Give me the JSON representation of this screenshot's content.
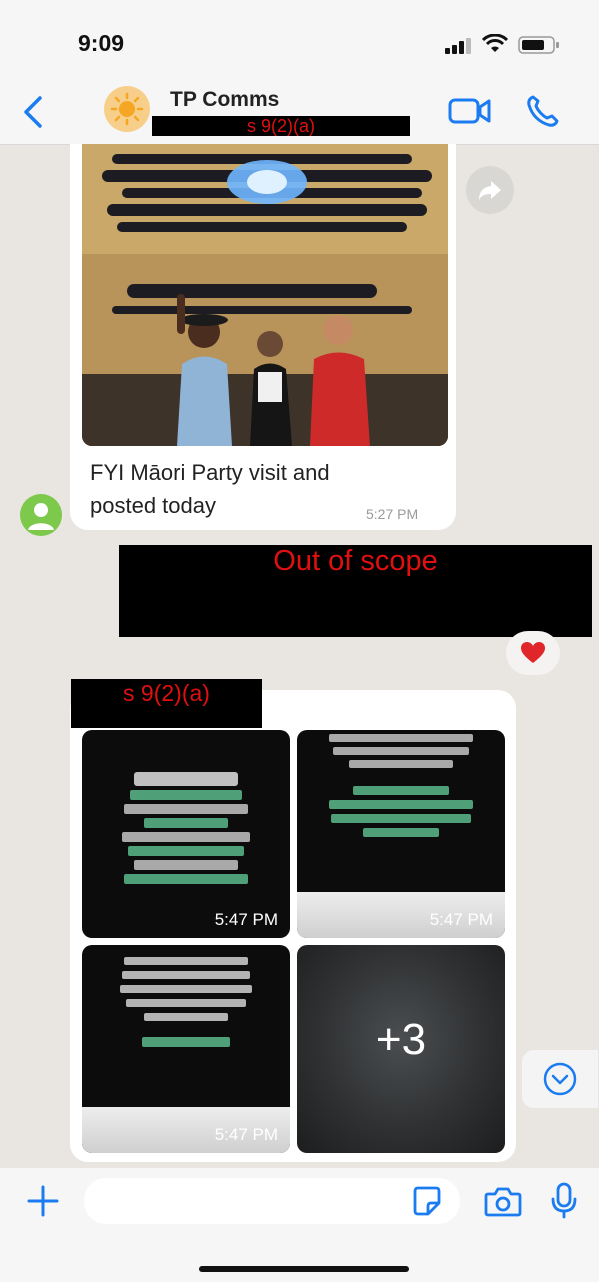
{
  "status_bar": {
    "time": "9:09"
  },
  "header": {
    "contact_name": "TP Comms",
    "redaction_label": "s 9(2)(a)"
  },
  "messages": [
    {
      "type": "image",
      "caption": "FYI Māori Party visit and posted today",
      "timestamp": "5:27 PM"
    },
    {
      "type": "redacted",
      "label": "Out of scope",
      "reaction": "heart"
    },
    {
      "type": "album",
      "sender_redaction": "s 9(2)(a)",
      "tiles": [
        {
          "timestamp": "5:47 PM"
        },
        {
          "timestamp": "5:47 PM"
        },
        {
          "timestamp": "5:47 PM"
        },
        {
          "more_count": "+3"
        }
      ]
    }
  ],
  "colors": {
    "accent": "#1a7cf0",
    "redaction_text": "#e01010",
    "reaction": "#e0262b"
  },
  "icons": [
    "back-chevron-icon",
    "video-call-icon",
    "voice-call-icon",
    "forward-icon",
    "chevron-down-icon",
    "plus-icon",
    "sticker-icon",
    "camera-icon",
    "microphone-icon"
  ]
}
